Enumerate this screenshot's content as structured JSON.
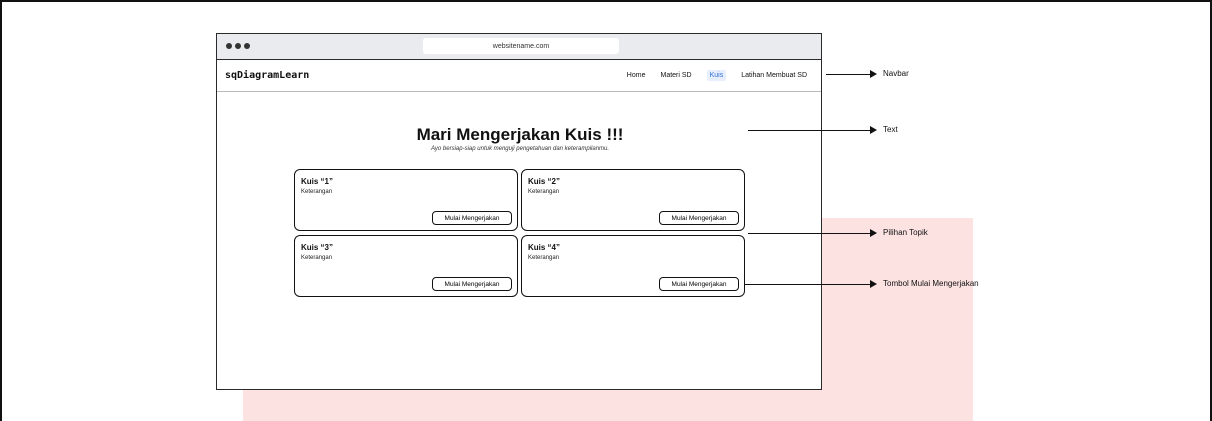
{
  "browser": {
    "url": "websitename.com"
  },
  "navbar": {
    "brand": "sqDiagramLearn",
    "links": [
      "Home",
      "Materi SD",
      "Kuis",
      "Latihan Membuat SD"
    ],
    "active_index": 2
  },
  "hero": {
    "title": "Mari Mengerjakan Kuis !!!",
    "subtitle": "Ayo bersiap-siap untuk menguji pengetahuan dan keterampilanmu."
  },
  "cards": [
    {
      "title": "Kuis “1”",
      "description": "Keterangan",
      "button": "Mulai Mengerjakan"
    },
    {
      "title": "Kuis “2”",
      "description": "Keterangan",
      "button": "Mulai Mengerjakan"
    },
    {
      "title": "Kuis “3”",
      "description": "Keterangan",
      "button": "Mulai Mengerjakan"
    },
    {
      "title": "Kuis “4”",
      "description": "Keterangan",
      "button": "Mulai Mengerjakan"
    }
  ],
  "annotations": [
    "Navbar",
    "Text",
    "Pilihan Topik",
    "Tombol Mulai Mengerjakan"
  ],
  "colors": {
    "accent": "#2f6fd0",
    "background_block": "#fde2e2",
    "chrome": "#e9ebee"
  }
}
